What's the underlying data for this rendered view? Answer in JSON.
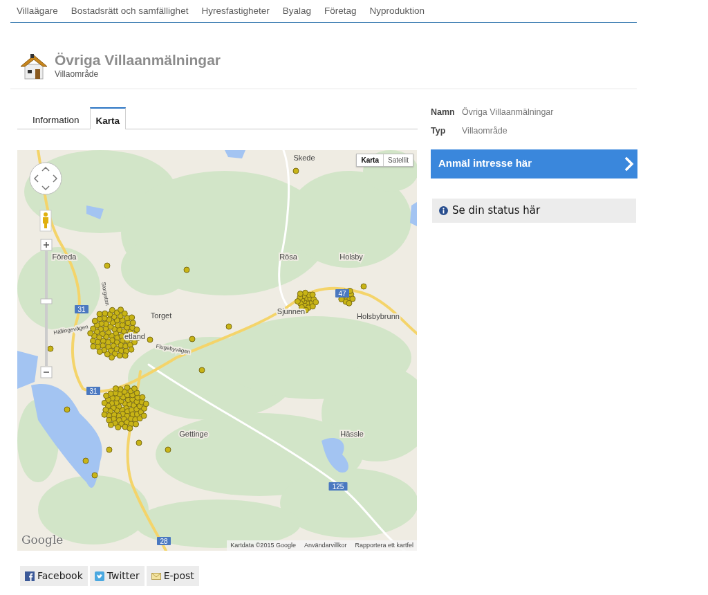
{
  "nav": [
    "Villaägare",
    "Bostadsrätt och samfällighet",
    "Hyresfastigheter",
    "Byalag",
    "Företag",
    "Nyproduktion"
  ],
  "header": {
    "title": "Övriga Villaanmälningar",
    "subtitle": "Villaområde"
  },
  "tabs": [
    {
      "label": "Information",
      "selected": false
    },
    {
      "label": "Karta",
      "selected": true
    }
  ],
  "map": {
    "type_buttons": [
      {
        "label": "Karta",
        "selected": true
      },
      {
        "label": "Satellit",
        "selected": false
      }
    ],
    "places": [
      {
        "kind": "town",
        "label": "Skede"
      },
      {
        "kind": "town",
        "label": "Föreda"
      },
      {
        "kind": "town",
        "label": "Rösa"
      },
      {
        "kind": "town",
        "label": "Holsby"
      },
      {
        "kind": "town",
        "label": "Torget"
      },
      {
        "kind": "town",
        "label": "Sjunnen"
      },
      {
        "kind": "town",
        "label": "Holsbybrunn"
      },
      {
        "kind": "town",
        "label": "etland"
      },
      {
        "kind": "town",
        "label": "Gettinge"
      },
      {
        "kind": "town",
        "label": "Hässle"
      },
      {
        "kind": "street",
        "label": "Storgatan"
      },
      {
        "kind": "street",
        "label": "Hällingevägen"
      },
      {
        "kind": "street",
        "label": "Flugebyvägen"
      }
    ],
    "road_numbers": [
      "31",
      "31",
      "47",
      "125",
      "28"
    ],
    "logo": "Google",
    "attribution": [
      "Kartdata ©2015 Google",
      "Användarvillkor",
      "Rapportera ett kartfel"
    ]
  },
  "details": [
    {
      "label": "Namn",
      "value": "Övriga Villaanmälningar"
    },
    {
      "label": "Typ",
      "value": "Villaområde"
    }
  ],
  "cta": "Anmäl intresse här",
  "status_link": "Se din status här",
  "share": [
    {
      "kind": "facebook",
      "label": "Facebook"
    },
    {
      "kind": "twitter",
      "label": "Twitter"
    },
    {
      "kind": "email",
      "label": "E-post"
    }
  ]
}
